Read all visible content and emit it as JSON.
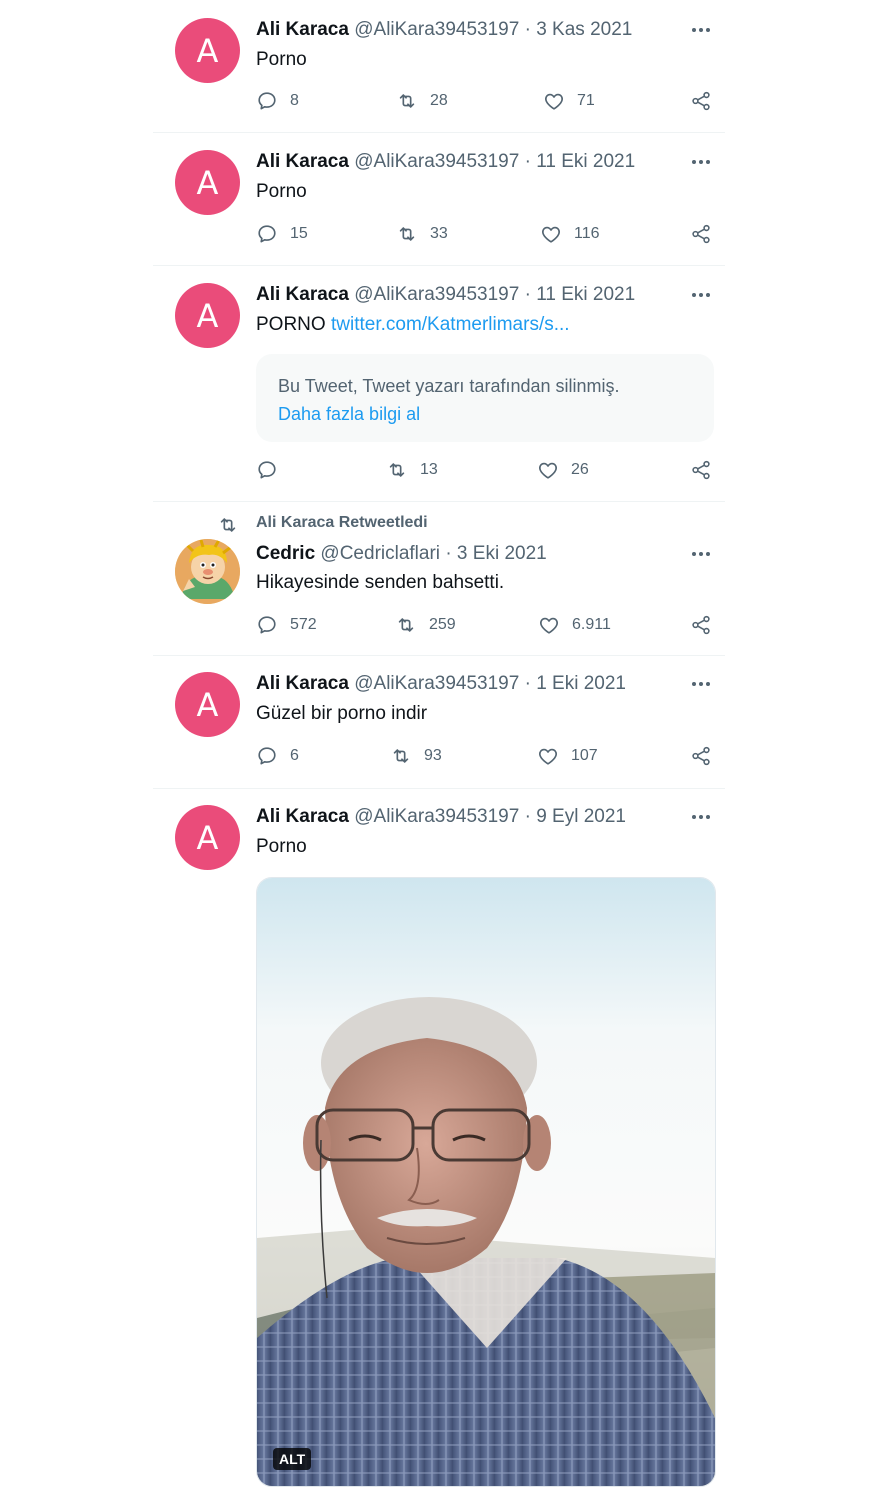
{
  "tweets": [
    {
      "avatar_letter": "A",
      "name": "Ali Karaca",
      "handle": "@AliKara39453197",
      "sep": "·",
      "date": "3 Kas 2021",
      "text": "Porno",
      "replies": "8",
      "retweets": "28",
      "likes": "71"
    },
    {
      "avatar_letter": "A",
      "name": "Ali Karaca",
      "handle": "@AliKara39453197",
      "sep": "·",
      "date": "11 Eki 2021",
      "text": "Porno",
      "replies": "15",
      "retweets": "33",
      "likes": "116"
    },
    {
      "avatar_letter": "A",
      "name": "Ali Karaca",
      "handle": "@AliKara39453197",
      "sep": "·",
      "date": "11 Eki 2021",
      "text": "PORNO",
      "link": "twitter.com/Katmerlimars/s...",
      "quoted_notice": "Bu Tweet, Tweet yazarı tarafından silinmiş.",
      "quoted_more": "Daha fazla bilgi al",
      "replies": "",
      "retweets": "13",
      "likes": "26"
    },
    {
      "retweet_label": "Ali Karaca Retweetledi",
      "name": "Cedric",
      "handle": "@Cedriclaflari",
      "sep": "·",
      "date": "3 Eki 2021",
      "text": "Hikayesinde senden bahsetti.",
      "replies": "572",
      "retweets": "259",
      "likes": "6.911"
    },
    {
      "avatar_letter": "A",
      "name": "Ali Karaca",
      "handle": "@AliKara39453197",
      "sep": "·",
      "date": "1 Eki 2021",
      "text": "Güzel bir porno indir",
      "replies": "6",
      "retweets": "93",
      "likes": "107"
    },
    {
      "avatar_letter": "A",
      "name": "Ali Karaca",
      "handle": "@AliKara39453197",
      "sep": "·",
      "date": "9 Eyl 2021",
      "text": "Porno",
      "media_alt_badge": "ALT"
    }
  ],
  "colors": {
    "avatar": "#ea4c7a",
    "link": "#1d9bf0",
    "secondary": "#536471"
  }
}
